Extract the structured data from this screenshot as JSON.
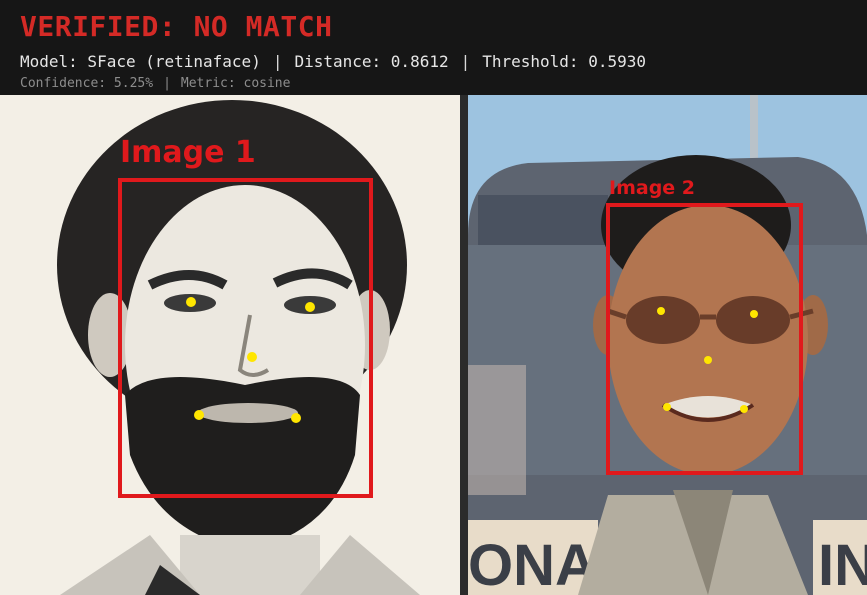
{
  "verdict": {
    "text": "VERIFIED: NO MATCH",
    "color": "#d42a26"
  },
  "metrics": {
    "model": "Model: SFace (retinaface)",
    "distance": "Distance: 0.8612",
    "threshold": "Threshold: 0.5930",
    "separator": "|"
  },
  "details": {
    "confidence": "Confidence: 5.25%",
    "metric": "Metric: cosine",
    "separator": "|"
  },
  "images": [
    {
      "label": "Image 1",
      "box_color": "#e0191c",
      "landmark_color": "#ffe600"
    },
    {
      "label": "Image 2",
      "box_color": "#e0191c",
      "landmark_color": "#ffe600"
    }
  ],
  "background_sign": {
    "left_text": "ONAL",
    "right_text": "IN"
  }
}
